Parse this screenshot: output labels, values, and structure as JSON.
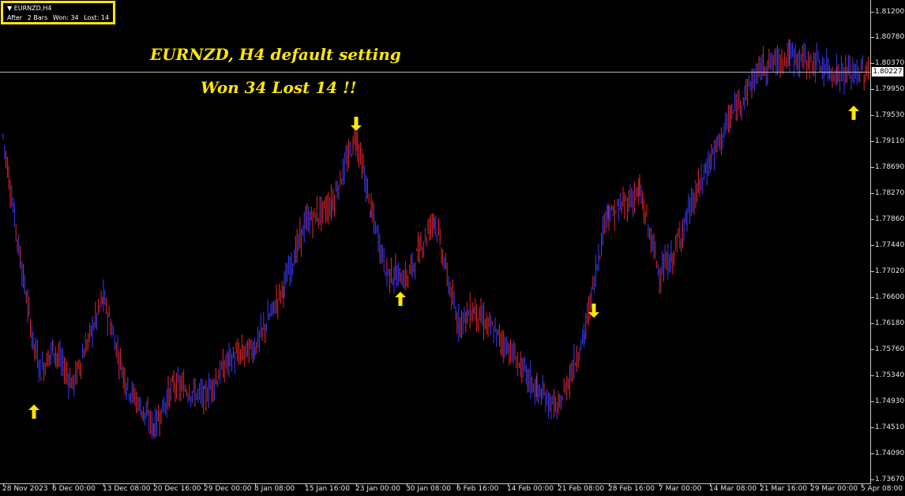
{
  "chart_info": {
    "symbol": "EURNZD,H4",
    "after_label": "After",
    "bars_label": "2 Bars",
    "won_label": "Won: 34",
    "lost_label": "Lost: 14"
  },
  "headline": {
    "line1": "EURNZD, H4  default setting",
    "line2": "Won 34  Lost 14  !!"
  },
  "current_price": "1.80227",
  "colors": {
    "up_bar": "#e8262a",
    "down_bar": "#3b3bff",
    "arrow": "#ffe800",
    "background": "#000000"
  },
  "price_axis": [
    "1.81200",
    "1.80780",
    "1.80370",
    "1.79950",
    "1.79530",
    "1.79110",
    "1.78690",
    "1.78270",
    "1.77860",
    "1.77440",
    "1.77020",
    "1.76600",
    "1.76180",
    "1.75760",
    "1.75340",
    "1.74930",
    "1.74510",
    "1.74090",
    "1.73670"
  ],
  "time_axis": [
    "28 Nov 2023",
    "6 Dec 00:00",
    "13 Dec 08:00",
    "20 Dec 16:00",
    "29 Dec 00:00",
    "8 Jan 08:00",
    "15 Jan 16:00",
    "23 Jan 00:00",
    "30 Jan 08:00",
    "6 Feb 16:00",
    "14 Feb 00:00",
    "21 Feb 08:00",
    "28 Feb 16:00",
    "7 Mar 00:00",
    "14 Mar 08:00",
    "21 Mar 16:00",
    "29 Mar 00:00",
    "5 Apr 08:00"
  ],
  "signals": [
    {
      "direction": "up",
      "icon": "up-arrow-icon"
    },
    {
      "direction": "down",
      "icon": "down-arrow-icon"
    },
    {
      "direction": "up",
      "icon": "up-arrow-icon"
    },
    {
      "direction": "down",
      "icon": "down-arrow-icon"
    },
    {
      "direction": "up",
      "icon": "up-arrow-icon"
    }
  ],
  "chart_data": {
    "type": "ohlc",
    "symbol": "EURNZD",
    "timeframe": "H4",
    "ylim": [
      1.7367,
      1.812
    ],
    "anchor_closes": [
      [
        "28 Nov 2023",
        1.792
      ],
      [
        "30 Nov",
        1.772
      ],
      [
        "2 Dec",
        1.759
      ],
      [
        "4 Dec",
        1.754
      ],
      [
        "6 Dec",
        1.758
      ],
      [
        "9 Dec",
        1.752
      ],
      [
        "13 Dec",
        1.766
      ],
      [
        "16 Dec",
        1.752
      ],
      [
        "20 Dec",
        1.745
      ],
      [
        "23 Dec",
        1.752
      ],
      [
        "29 Dec",
        1.75
      ],
      [
        "3 Jan",
        1.756
      ],
      [
        "8 Jan",
        1.758
      ],
      [
        "12 Jan",
        1.768
      ],
      [
        "15 Jan",
        1.778
      ],
      [
        "19 Jan",
        1.781
      ],
      [
        "22 Jan",
        1.792
      ],
      [
        "25 Jan",
        1.78
      ],
      [
        "28 Jan",
        1.77
      ],
      [
        "30 Jan",
        1.769
      ],
      [
        "2 Feb",
        1.779
      ],
      [
        "6 Feb",
        1.762
      ],
      [
        "9 Feb",
        1.764
      ],
      [
        "14 Feb",
        1.758
      ],
      [
        "17 Feb",
        1.751
      ],
      [
        "20 Feb",
        1.748
      ],
      [
        "21 Feb",
        1.76
      ],
      [
        "24 Feb",
        1.781
      ],
      [
        "28 Feb",
        1.779
      ],
      [
        "2 Mar",
        1.783
      ],
      [
        "5 Mar",
        1.77
      ],
      [
        "7 Mar",
        1.772
      ],
      [
        "11 Mar",
        1.779
      ],
      [
        "14 Mar",
        1.788
      ],
      [
        "18 Mar",
        1.795
      ],
      [
        "21 Mar",
        1.803
      ],
      [
        "25 Mar",
        1.805
      ],
      [
        "29 Mar",
        1.804
      ],
      [
        "2 Apr",
        1.802
      ],
      [
        "5 Apr",
        1.8023
      ]
    ]
  }
}
